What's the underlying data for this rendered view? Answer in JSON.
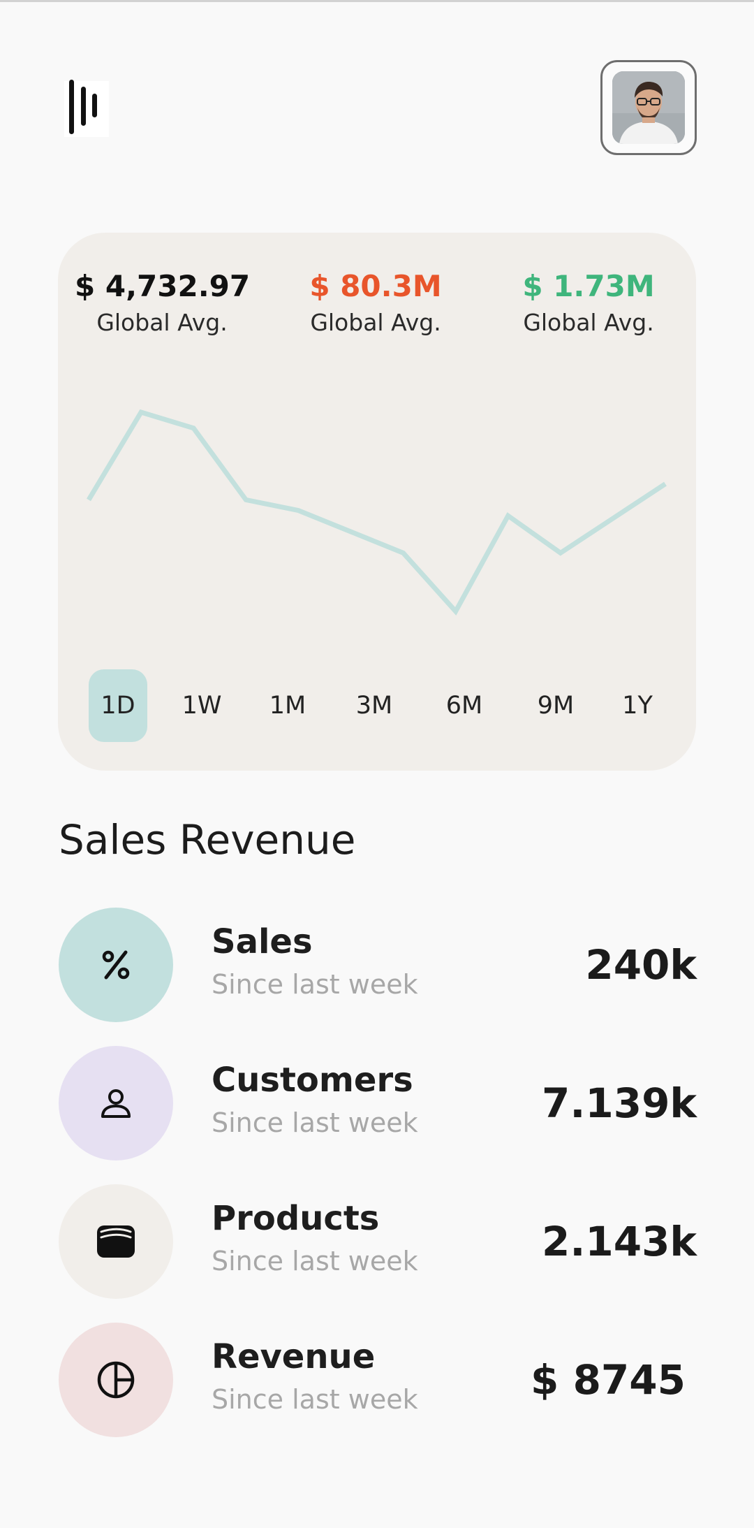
{
  "header": {
    "menu_icon": "menu-bars-icon",
    "avatar_icon": "user-avatar-photo"
  },
  "stats": [
    {
      "value": "$ 4,732.97",
      "label": "Global Avg.",
      "color": "#111111"
    },
    {
      "value": "$ 80.3M",
      "label": "Global Avg.",
      "color": "#e8552b"
    },
    {
      "value": "$ 1.73M",
      "label": "Global Avg.",
      "color": "#3fb57c"
    }
  ],
  "chart_data": {
    "type": "line",
    "x": [
      0,
      1,
      2,
      3,
      4,
      5,
      6,
      7,
      8,
      9,
      10,
      11
    ],
    "values": [
      52,
      85,
      79,
      52,
      48,
      40,
      32,
      10,
      46,
      32,
      45,
      58
    ],
    "ylim": [
      0,
      100
    ],
    "grid": false,
    "color": "#c3e0dd"
  },
  "ranges": [
    {
      "label": "1D",
      "active": true
    },
    {
      "label": "1W",
      "active": false
    },
    {
      "label": "1M",
      "active": false
    },
    {
      "label": "3M",
      "active": false
    },
    {
      "label": "6M",
      "active": false
    },
    {
      "label": "9M",
      "active": false
    },
    {
      "label": "1Y",
      "active": false
    }
  ],
  "section": {
    "title": "Sales Revenue"
  },
  "metrics": [
    {
      "title": "Sales",
      "subtitle": "Since last week",
      "value": "240k",
      "icon": "percent-icon",
      "bg": "#c2e0de"
    },
    {
      "title": "Customers",
      "subtitle": "Since last week",
      "value": "7.139k",
      "icon": "person-icon",
      "bg": "#e6e0f2"
    },
    {
      "title": "Products",
      "subtitle": "Since last week",
      "value": "2.143k",
      "icon": "wallet-icon",
      "bg": "#f1eeea"
    },
    {
      "title": "Revenue",
      "subtitle": "Since last week",
      "value": "$ 8745",
      "icon": "pie-chart-icon",
      "bg": "#f1e0e0"
    }
  ]
}
